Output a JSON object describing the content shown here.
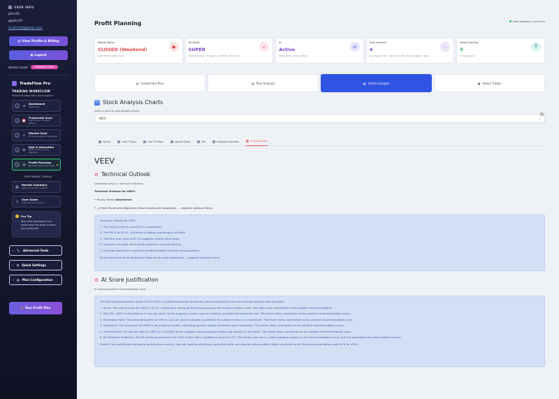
{
  "sidebar": {
    "user_info_label": "USER INFO",
    "username": "john10",
    "handle": "@john10",
    "email": "john10@gmail.com",
    "view_profile_label": "View Profile & Billing",
    "logout_label": "Logout",
    "access_label": "Access Level:",
    "access_badge": "PREMIUM USER",
    "brand": "TradeFlow Pro",
    "workflow_title": "TRADING WORKFLOW",
    "workflow_sub": "Follow the steps from top to bottom",
    "workflow": [
      {
        "num": "1",
        "name": "Dashboard",
        "desc": "Start here"
      },
      {
        "num": "2",
        "name": "Premarket Scan",
        "desc": "Catch early breakout setups"
      },
      {
        "num": "3",
        "name": "Market Scan",
        "desc": "Find day-session breakouts"
      },
      {
        "num": "4",
        "name": "Risk & Allocation",
        "desc": "Balance risk before planning"
      },
      {
        "num": "5",
        "name": "Profit Planning",
        "desc": "Build the final trade plan"
      }
    ],
    "optional_label": "OPTIONAL TOOLS",
    "optional": [
      {
        "name": "Market Summary",
        "desc": "Optional market analysis"
      },
      {
        "name": "User Guide",
        "desc": "Help and instructions"
      }
    ],
    "tip_title": "Pro Tip",
    "tip_text": "Start with Dashboard, then move down the steps to reach your profit plan",
    "advanced_tools": "Advanced Tools",
    "quick_settings": "Quick Settings",
    "plan_config": "Plan Configuration",
    "run_label": "Run Profit Plan"
  },
  "header": {
    "title": "Profit Planning",
    "live": "Data updates in real-time"
  },
  "cards": [
    {
      "label": "Market Status",
      "value": "CLOSED (Weekend)",
      "sub": "09:52 PM ET custom check",
      "color": "#e5484d",
      "icon_bg": "#fde3e3"
    },
    {
      "label": "ML Model",
      "value": "SUPER",
      "sub": "Model: 6 models · 11 features · 0.4% F1 · 88.3% Acc",
      "color": "#7a3fd6",
      "icon_bg": "#fbe1ee"
    },
    {
      "label": "AI",
      "value": "Active",
      "sub": "Model: GPT-4.1 Turbo 128k ctx",
      "color": "#7a3fd6",
      "icon_bg": "#e2e5fb"
    },
    {
      "label": "Scan Sessions",
      "value": "4",
      "sub": "Scan Session (13) · Last Run: 20:38 · Sources: Alpaca · Yahoo",
      "color": "#7a3fd6",
      "icon_bg": "#ece4fb"
    },
    {
      "label": "Active Tracking",
      "value": "5",
      "sub": "5 Trades Active",
      "color": "#2fb36a",
      "icon_bg": "#dff1f5"
    }
  ],
  "tabs": [
    {
      "label": "Investment Plan",
      "active": false
    },
    {
      "label": "Plan Analysis",
      "active": false
    },
    {
      "label": "Charts Analysis",
      "active": true
    },
    {
      "label": "Active Trades",
      "active": false
    }
  ],
  "charts": {
    "section_title": "Stock Analysis Charts",
    "select_label": "Select a stock to view detailed charts:",
    "select_value": "VEEV",
    "subtabs": [
      {
        "label": "Hourly",
        "active": false
      },
      {
        "label": "Last 7 Days",
        "active": false
      },
      {
        "label": "Last 30 Days",
        "active": false
      },
      {
        "label": "Last 60 Days",
        "active": false
      },
      {
        "label": "RSI",
        "active": false
      },
      {
        "label": "Analysis Overview",
        "active": false
      },
      {
        "label": "AI Justification",
        "active": true
      }
    ]
  },
  "content": {
    "symbol": "VEEV",
    "technical_title": "Technical Outlook",
    "generated": "Generated using AI • technical indicators",
    "outlook_for": "Technical Outlook for VEEV:",
    "hourly_prefix": "• Hourly Trend: ",
    "hourly_value": "downtrend",
    "mtf_line": "• 📊 Multi-Timeframe Alignment: Most trends point downward — negative pressure likely.",
    "box1": {
      "title": "Technical Outlook for VEEV:",
      "items": [
        "1.  The hourly trend is currently in a downtrend.",
        "2.  The RSI is at 61.41, indicating a slightly overbought condition.",
        "3.  The technical score of 81.20 suggests strong momentum.",
        "4.  Support is at lower levels while resistance may be forming.",
        "5.  Consider waiting for a potential pullback before entering strong position."
      ],
      "footer": "Multi-Timeframe Trend Alignment: Most trends point downward — negative pressure likely."
    },
    "ai_title": "AI Score Justification",
    "ai_meta": "AI reasoning behind recommendation score",
    "box2": {
      "title": "The final recommendation score of 8 for VEEV is justified based on several key influencing factors from the trading analysis data provided:",
      "items": [
        "1.  Score: The overall score for VEEV is 81.20, indicating a strong performance based on the analysis metrics used. This high score contributes to the positive recommendation.",
        "2.  Risk Tier: VEEV is classified as a Low-risk stock, which suggests a lower level of volatility and potential downside risk. This factor likely contributes to the positive recommendation score.",
        "3.  Estimated Profit: The estimated profit for VEEV is $20.00, which indicates a potential for a decent return on investment. This factor likely contributes to the positive recommendation score.",
        "4.  Sentiment: The sentiment for VEEV is described as bullish, indicating positive market sentiment and momentum. This factor likely contributes to the positive recommendation score.",
        "5.  Volume Ratio: The volume ratio for VEEV is 3.125363, which suggests strong trading activity and liquidity in the stock. This factor likely contributes to the positive recommendation score.",
        "6.  ML Breakout Prediction: The ML breakout prediction for VEEV is FAIL with a confidence level of 1.9%. This factor may have a slight negative impact on the recommendation score, but it is outweighed by other positive factors."
      ],
      "footer": "Overall, the combination of strong performance metrics, low risk, positive sentiment, potential profit, and strong trading activity likely contribute to the final recommendation score of 8 for VEEV."
    }
  }
}
